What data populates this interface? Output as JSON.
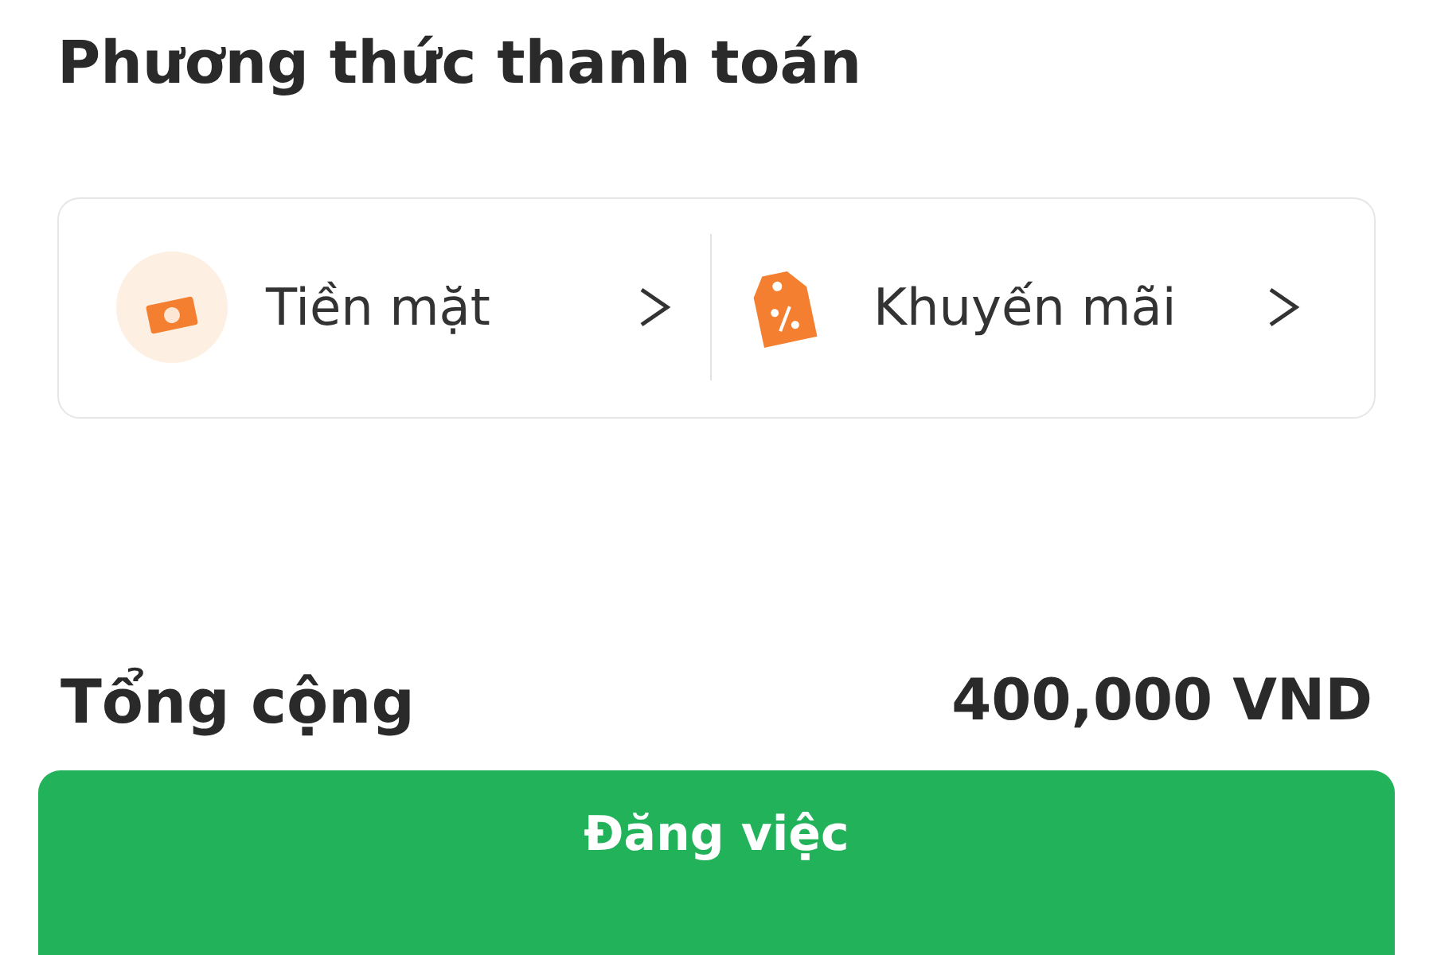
{
  "title": "Phương thức thanh toán",
  "options": [
    {
      "kind": "cash",
      "label": "Tiền mặt"
    },
    {
      "kind": "promo",
      "label": "Khuyến mãi"
    }
  ],
  "total": {
    "label": "Tổng cộng",
    "value": "400,000 VND"
  },
  "submit_button": "Đăng việc"
}
